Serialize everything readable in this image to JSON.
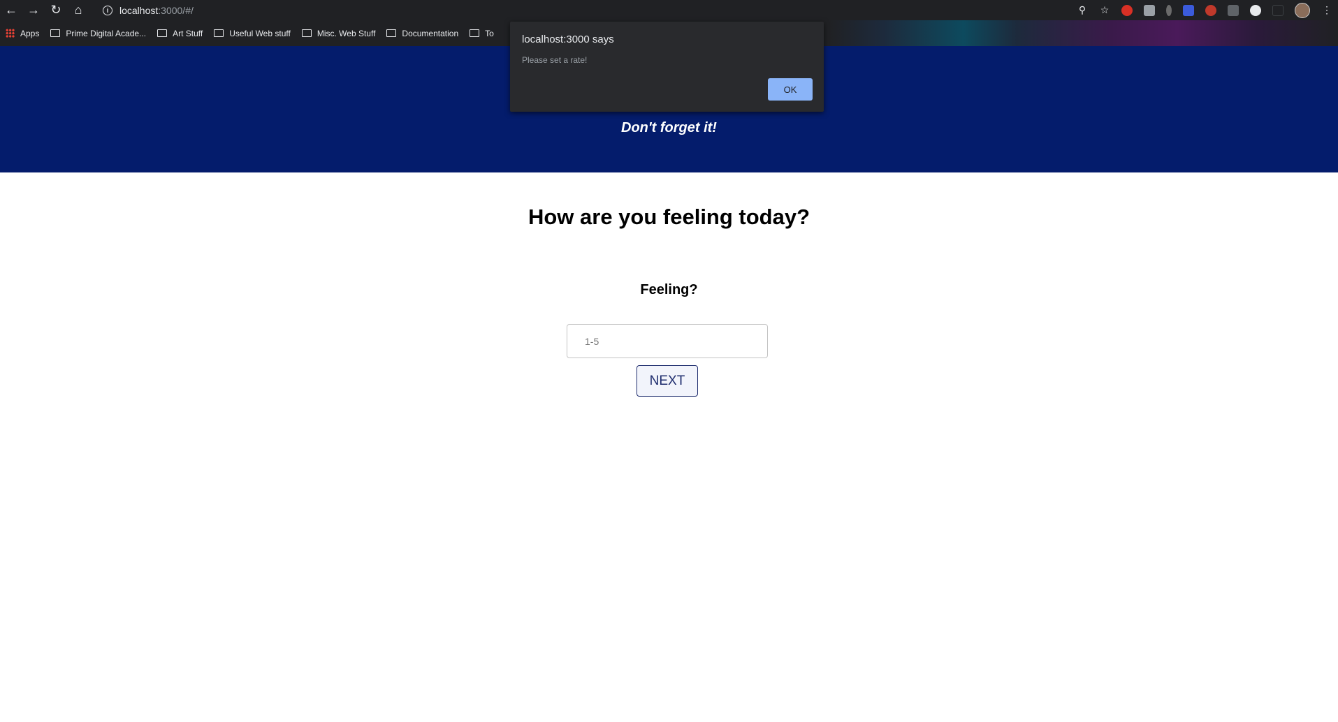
{
  "browser": {
    "url_host": "localhost",
    "url_rest": ":3000/#/",
    "bookmarks": [
      {
        "label": "Apps",
        "icon": "apps-grid-icon"
      },
      {
        "label": "Prime Digital Acade...",
        "icon": "folder-icon"
      },
      {
        "label": "Art Stuff",
        "icon": "folder-icon"
      },
      {
        "label": "Useful Web stuff",
        "icon": "folder-icon"
      },
      {
        "label": "Misc. Web Stuff",
        "icon": "folder-icon"
      },
      {
        "label": "Documentation",
        "icon": "folder-icon"
      },
      {
        "label": "To",
        "icon": "folder-icon"
      }
    ]
  },
  "header": {
    "tagline": "Don't forget it!",
    "background_color": "#041c6c"
  },
  "main": {
    "headline": "How are you feeling today?",
    "field_label": "Feeling?",
    "input_placeholder": "1-5",
    "input_value": "",
    "next_label": "NEXT"
  },
  "alert": {
    "title": "localhost:3000 says",
    "message": "Please set a rate!",
    "ok_label": "OK",
    "ok_color": "#8ab4f8"
  }
}
